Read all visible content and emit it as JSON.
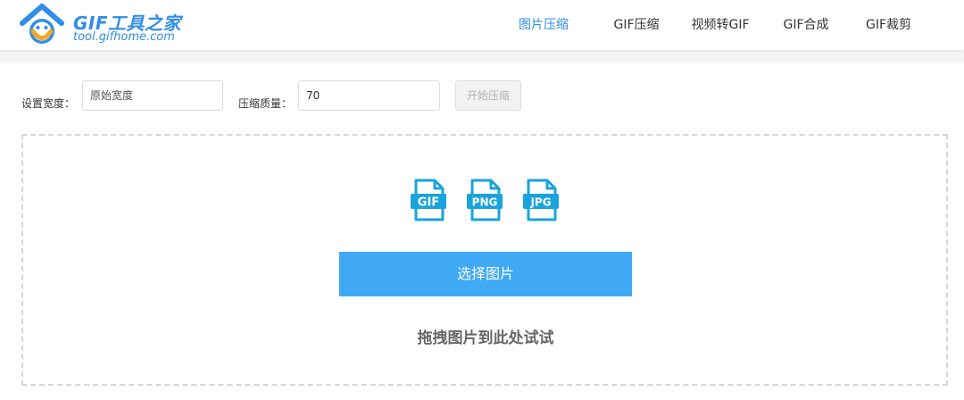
{
  "header": {
    "logo": {
      "title": "GIF工具之家",
      "subtitle": "tool.gifhome.com"
    },
    "nav": [
      {
        "label": "图片压缩",
        "active": true
      },
      {
        "label": "GIF压缩",
        "active": false
      },
      {
        "label": "视频转GIF",
        "active": false
      },
      {
        "label": "GIF合成",
        "active": false
      },
      {
        "label": "GIF裁剪",
        "active": false
      }
    ]
  },
  "toolbar": {
    "width_label": "设置宽度：",
    "width_placeholder": "原始宽度",
    "width_value": "",
    "quality_label": "压缩质量：",
    "quality_value": "70",
    "start_label": "开始压缩"
  },
  "dropzone": {
    "file_types": [
      {
        "label": "GIF",
        "icon": "gif-file-icon"
      },
      {
        "label": "PNG",
        "icon": "png-file-icon"
      },
      {
        "label": "JPG",
        "icon": "jpg-file-icon"
      }
    ],
    "select_label": "选择图片",
    "hint": "拖拽图片到此处试试"
  },
  "colors": {
    "accent": "#2f8ee5",
    "button": "#3fa9f5",
    "file_icon": "#1aa3dc",
    "logo_orange": "#f5a623"
  }
}
